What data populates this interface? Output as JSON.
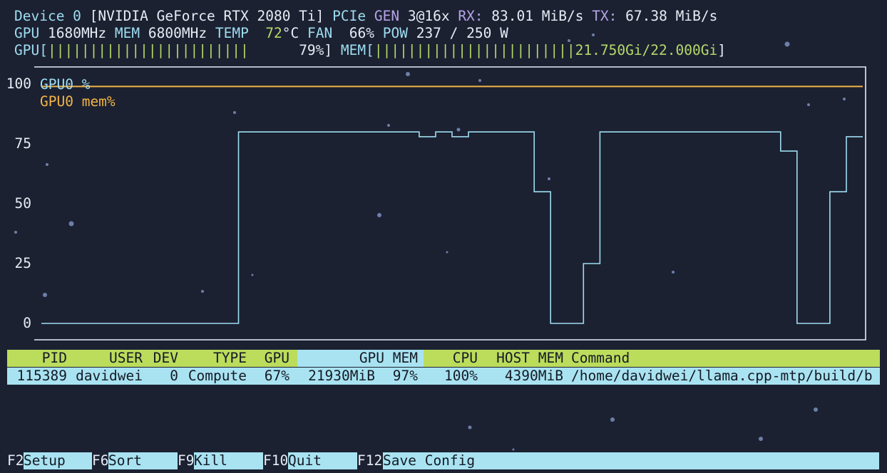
{
  "header": {
    "device_label": "Device 0",
    "device_name": "[NVIDIA GeForce RTX 2080 Ti]",
    "pcie_label": "PCIe",
    "gen_label": "GEN",
    "gen_value": "3@16x",
    "rx_label": "RX:",
    "rx_value": "83.01 MiB/s",
    "tx_label": "TX:",
    "tx_value": "67.38 MiB/s",
    "gpu_label": "GPU",
    "gpu_clock": "1680MHz",
    "mem_label": "MEM",
    "mem_clock": "6800MHz",
    "temp_label": "TEMP",
    "temp_value": "72",
    "temp_unit": "°C",
    "fan_label": "FAN",
    "fan_value": "66%",
    "pow_label": "POW",
    "pow_value": "237 / 250 W",
    "gpu_bar_label": "GPU[",
    "gpu_bar_fill": "||||||||||||||||||||||||",
    "gpu_bar_value": "79%]",
    "gpu_util_fraction": 0.79,
    "mem_bar_label": "MEM[",
    "mem_bar_fill": "||||||||||||||||||||||||",
    "mem_bar_value": "21.750Gi/22.000Gi",
    "mem_bar_close": "]"
  },
  "chart_data": {
    "type": "line",
    "ylim": [
      0,
      100
    ],
    "y_ticks": [
      "100",
      "75",
      "50",
      "25",
      "0"
    ],
    "grid": false,
    "legend_position": "top-left",
    "series": [
      {
        "name": "GPU0 %",
        "color": "#9fdcf0",
        "step": true,
        "values": [
          0,
          0,
          0,
          0,
          0,
          0,
          0,
          0,
          0,
          0,
          0,
          0,
          80,
          80,
          80,
          80,
          80,
          80,
          80,
          80,
          80,
          80,
          80,
          78,
          80,
          78,
          80,
          80,
          80,
          80,
          55,
          0,
          0,
          25,
          80,
          80,
          80,
          80,
          80,
          80,
          80,
          80,
          80,
          80,
          80,
          72,
          0,
          0,
          55,
          78
        ]
      },
      {
        "name": "GPU0 mem%",
        "color": "#f2b446",
        "step": true,
        "values": [
          99,
          99,
          99,
          99,
          99,
          99,
          99,
          99,
          99,
          99,
          99,
          99,
          99,
          99,
          99,
          99,
          99,
          99,
          99,
          99,
          99,
          99,
          99,
          99,
          99,
          99,
          99,
          99,
          99,
          99,
          99,
          99,
          99,
          99,
          99,
          99,
          99,
          99,
          99,
          99,
          99,
          99,
          99,
          99,
          99,
          99,
          99,
          99,
          99,
          99
        ]
      }
    ]
  },
  "process_table": {
    "columns": [
      "PID",
      "USER",
      "DEV",
      "TYPE",
      "GPU",
      "GPU MEM",
      "CPU",
      "HOST MEM",
      "Command"
    ],
    "rows": [
      {
        "pid": "115389",
        "user": "davidwei",
        "dev": "0",
        "type": "Compute",
        "gpu": "67%",
        "gpu_mem": "21930MiB",
        "gpu_mem_pct": "97%",
        "cpu": "100%",
        "host_mem": "4390MiB",
        "command": "/home/davidwei/llama.cpp-mtp/build/b"
      }
    ]
  },
  "function_keys": [
    {
      "key": "F2",
      "label": "Setup"
    },
    {
      "key": "F6",
      "label": "Sort"
    },
    {
      "key": "F9",
      "label": "Kill"
    },
    {
      "key": "F10",
      "label": "Quit"
    },
    {
      "key": "F12",
      "label": "Save Config"
    }
  ],
  "colors": {
    "background": "#1b2131",
    "cyan": "#9fdcf0",
    "purple": "#b7a4e8",
    "green": "#b5d96a",
    "orange": "#f2b446",
    "header_bar": "#bcdc5c",
    "row_highlight": "#a9e3f2"
  }
}
